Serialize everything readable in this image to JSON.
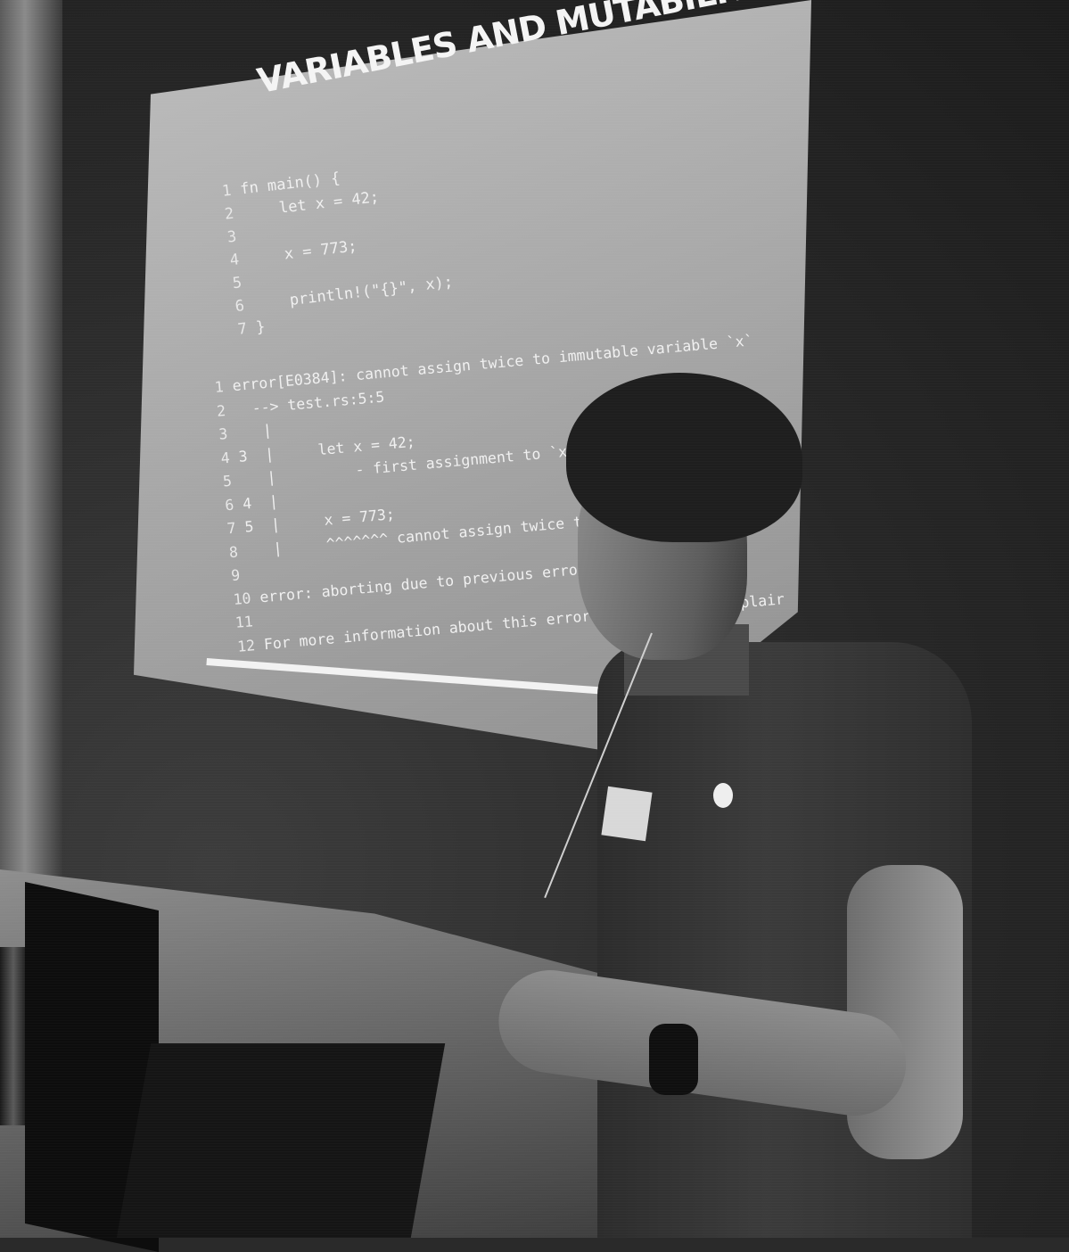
{
  "slide": {
    "title": "VARIABLES AND MUTABILITY",
    "code": [
      {
        "n": "1",
        "text": "fn main() {"
      },
      {
        "n": "2",
        "text": "    let x = 42;"
      },
      {
        "n": "3",
        "text": ""
      },
      {
        "n": "4",
        "text": "    x = 773;"
      },
      {
        "n": "5",
        "text": ""
      },
      {
        "n": "6",
        "text": "    println!(\"{}\", x);"
      },
      {
        "n": "7",
        "text": "}"
      }
    ],
    "output": [
      {
        "n": "1",
        "text": "error[E0384]: cannot assign twice to immutable variable `x`"
      },
      {
        "n": "2",
        "text": "  --> test.rs:5:5"
      },
      {
        "n": "3",
        "text": "   |"
      },
      {
        "n": "4",
        "text": "3  |     let x = 42;"
      },
      {
        "n": "5",
        "text": "   |         - first assignment to `x`"
      },
      {
        "n": "6",
        "text": "4  |"
      },
      {
        "n": "7",
        "text": "5  |     x = 773;"
      },
      {
        "n": "8",
        "text": "   |     ^^^^^^^ cannot assign twice to immutable vari"
      },
      {
        "n": "9",
        "text": ""
      },
      {
        "n": "10",
        "text": "error: aborting due to previous error"
      },
      {
        "n": "11",
        "text": ""
      },
      {
        "n": "12",
        "text": "For more information about this error, try `rustc --explair"
      }
    ]
  }
}
